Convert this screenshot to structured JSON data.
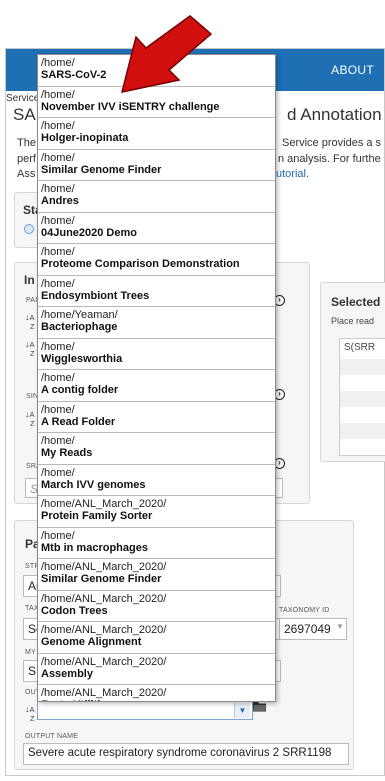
{
  "header": {
    "about_label": "ABOUT"
  },
  "service": {
    "crumb": "Service",
    "title_pre": "SA",
    "title_post": "d Annotation",
    "desc_lines": [
      {
        "left": "The",
        "right": "Service provides a s"
      },
      {
        "left": "perf",
        "right": "n analysis. For furthe"
      },
      {
        "left": "Ass",
        "right": "utorial."
      }
    ]
  },
  "start_panel": {
    "label": "Sta"
  },
  "input_panel": {
    "label": "In",
    "sub1": "PAI",
    "sub2": "SIN",
    "sub3": "SRA",
    "sra_value": "S"
  },
  "selected_panel": {
    "label": "Selected",
    "hint": "Place read",
    "first_row": "S(SRR"
  },
  "params_panel": {
    "label": "Pa",
    "strategy_label": "STR",
    "strategy_value": "Au",
    "taxonomy_label": "TAX",
    "taxonomy_value": "Se",
    "taxonomy_id_label": "TAXONOMY ID",
    "taxonomy_id_value": "2697049",
    "my_label": "MY",
    "my_value": "SI",
    "output_folder_label": "OUT",
    "output_name_label": "OUTPUT NAME",
    "output_name_value": "Severe acute respiratory syndrome coronavirus 2 SRR1198"
  },
  "folder_dropdown": {
    "items": [
      {
        "path": "/home/",
        "name": "SARS-CoV-2"
      },
      {
        "path": "/home/",
        "name": "November IVV iSENTRY challenge"
      },
      {
        "path": "/home/",
        "name": "Holger-inopinata"
      },
      {
        "path": "/home/",
        "name": "Similar Genome Finder"
      },
      {
        "path": "/home/",
        "name": "Andres"
      },
      {
        "path": "/home/",
        "name": "04June2020 Demo"
      },
      {
        "path": "/home/",
        "name": "Proteome Comparison Demonstration"
      },
      {
        "path": "/home/",
        "name": "Endosymbiont Trees"
      },
      {
        "path": "/home/Yeaman/",
        "name": "Bacteriophage"
      },
      {
        "path": "/home/",
        "name": "Wigglesworthia"
      },
      {
        "path": "/home/",
        "name": "A contig folder"
      },
      {
        "path": "/home/",
        "name": "A Read Folder"
      },
      {
        "path": "/home/",
        "name": "My Reads"
      },
      {
        "path": "/home/",
        "name": "March IVV genomes"
      },
      {
        "path": "/home/ANL_March_2020/",
        "name": "Protein Family Sorter"
      },
      {
        "path": "/home/",
        "name": "Mtb in macrophages"
      },
      {
        "path": "/home/ANL_March_2020/",
        "name": "Similar Genome Finder"
      },
      {
        "path": "/home/ANL_March_2020/",
        "name": "Codon Trees"
      },
      {
        "path": "/home/ANL_March_2020/",
        "name": "Genome Alignment"
      },
      {
        "path": "/home/ANL_March_2020/",
        "name": "Assembly"
      },
      {
        "path": "/home/ANL_March_2020/",
        "name": "Fasta Utilities"
      }
    ]
  },
  "colors": {
    "topbar": "#1f6fb5",
    "arrow": "#d10f0f"
  },
  "icons": [
    "sort-az-icon",
    "add-circle-icon",
    "folder-icon",
    "chevron-down-icon"
  ]
}
